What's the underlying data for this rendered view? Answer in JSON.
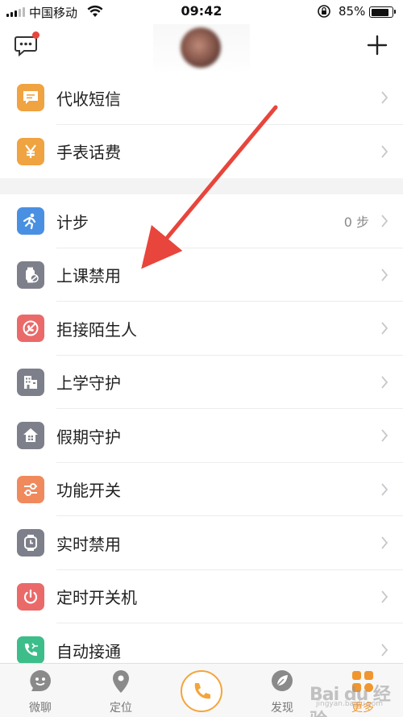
{
  "status_bar": {
    "carrier": "中国移动",
    "time": "09:42",
    "battery": "85%",
    "battery_level": 0.85
  },
  "header": {
    "messages_icon": "chat-bubble-icon",
    "add_icon": "plus-icon"
  },
  "groups": [
    {
      "items": [
        {
          "id": "sms",
          "label": "代收短信",
          "icon": "sms-icon",
          "color": "#f0a341"
        },
        {
          "id": "credit",
          "label": "手表话费",
          "icon": "yen-icon",
          "color": "#f0a341"
        }
      ]
    },
    {
      "items": [
        {
          "id": "steps",
          "label": "计步",
          "value": "0 步",
          "icon": "running-icon",
          "color": "#4a90e2"
        },
        {
          "id": "class-disable",
          "label": "上课禁用",
          "icon": "watch-block-icon",
          "color": "#7d7f8a"
        },
        {
          "id": "reject-strangers",
          "label": "拒接陌生人",
          "icon": "reject-call-icon",
          "color": "#ea6a6a"
        },
        {
          "id": "school-guard",
          "label": "上学守护",
          "icon": "building-icon",
          "color": "#7d7f8a"
        },
        {
          "id": "holiday-guard",
          "label": "假期守护",
          "icon": "home-icon",
          "color": "#7d7f8a"
        },
        {
          "id": "function-switch",
          "label": "功能开关",
          "icon": "sliders-icon",
          "color": "#f08a5d"
        },
        {
          "id": "realtime-disable",
          "label": "实时禁用",
          "icon": "watch-clock-icon",
          "color": "#7d7f8a"
        },
        {
          "id": "timed-power",
          "label": "定时开关机",
          "icon": "power-icon",
          "color": "#ea6a6a"
        },
        {
          "id": "auto-answer",
          "label": "自动接通",
          "icon": "phone-auto-icon",
          "color": "#3dbd8a"
        }
      ]
    }
  ],
  "tabbar": {
    "tabs": [
      {
        "id": "chat",
        "label": "微聊",
        "icon": "chat-face-icon"
      },
      {
        "id": "locate",
        "label": "定位",
        "icon": "location-pin-icon"
      },
      {
        "id": "call",
        "label": "",
        "icon": "phone-icon"
      },
      {
        "id": "discover",
        "label": "发现",
        "icon": "compass-leaf-icon"
      },
      {
        "id": "more",
        "label": "更多",
        "icon": "grid-icon",
        "active": true
      }
    ],
    "accent_color": "#f0962f"
  },
  "watermark": {
    "text": "Bai du 经验",
    "sub": "jingyan.baidu.com"
  }
}
